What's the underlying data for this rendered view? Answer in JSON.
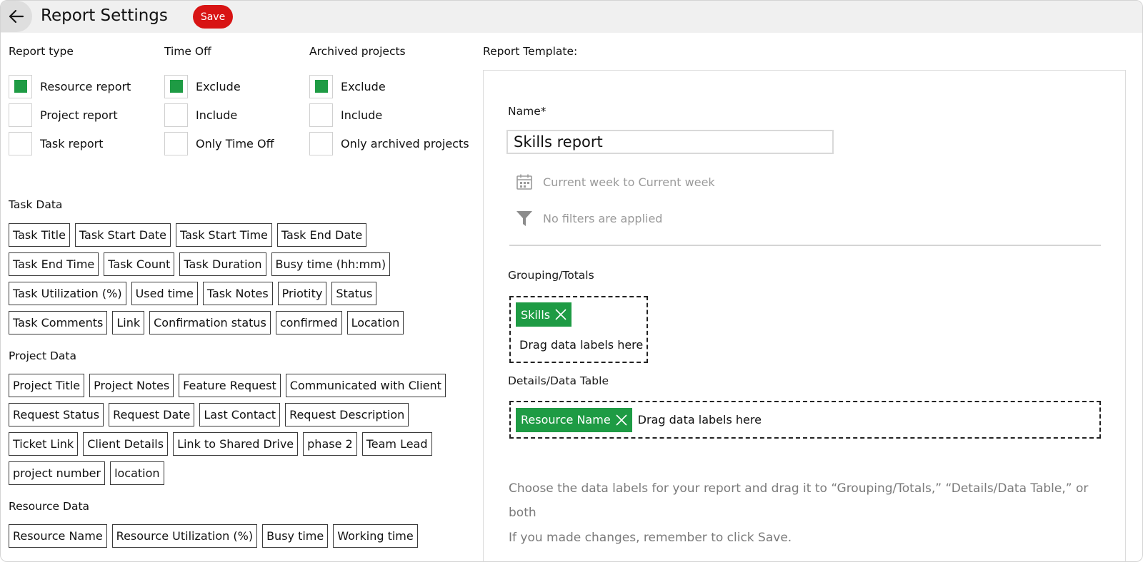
{
  "header": {
    "title": "Report Settings",
    "save_label": "Save"
  },
  "report_type": {
    "label": "Report type",
    "options": [
      {
        "label": "Resource report",
        "checked": true
      },
      {
        "label": "Project report",
        "checked": false
      },
      {
        "label": "Task report",
        "checked": false
      }
    ]
  },
  "time_off": {
    "label": "Time Off",
    "options": [
      {
        "label": "Exclude",
        "checked": true
      },
      {
        "label": "Include",
        "checked": false
      },
      {
        "label": "Only Time Off",
        "checked": false
      }
    ]
  },
  "archived": {
    "label": "Archived projects",
    "options": [
      {
        "label": "Exclude",
        "checked": true
      },
      {
        "label": "Include",
        "checked": false
      },
      {
        "label": "Only archived projects",
        "checked": false
      }
    ]
  },
  "task_data": {
    "label": "Task Data",
    "rows": [
      [
        "Task Title",
        "Task Start Date",
        "Task Start Time",
        "Task End Date"
      ],
      [
        "Task End Time",
        "Task Count",
        "Task Duration",
        "Busy time (hh:mm)"
      ],
      [
        "Task Utilization (%)",
        "Used time",
        "Task Notes",
        "Priotity",
        "Status"
      ],
      [
        "Task Comments",
        "Link",
        "Confirmation status",
        "confirmed",
        "Location"
      ]
    ]
  },
  "project_data": {
    "label": "Project Data",
    "rows": [
      [
        "Project Title",
        "Project Notes",
        "Feature Request",
        "Communicated with Client"
      ],
      [
        "Request Status",
        "Request Date",
        "Last Contact",
        "Request Description"
      ],
      [
        "Ticket Link",
        "Client Details",
        "Link to Shared Drive",
        "phase 2",
        "Team Lead"
      ],
      [
        "project number",
        "location"
      ]
    ]
  },
  "resource_data": {
    "label": "Resource Data",
    "rows": [
      [
        "Resource Name",
        "Resource Utilization (%)",
        "Busy time",
        "Working time"
      ]
    ]
  },
  "template": {
    "title": "Report Template:",
    "name_label": "Name*",
    "name_value": "Skills report",
    "date_range": "Current week to Current week",
    "filters": "No filters are applied",
    "grouping_label": "Grouping/Totals",
    "grouping_chips": [
      "Skills"
    ],
    "grouping_hint": "Drag data labels here",
    "details_label": "Details/Data Table",
    "details_chips": [
      "Resource Name"
    ],
    "details_hint": "Drag data labels here",
    "help_line1": "Choose the data labels for your report and drag it to “Grouping/Totals,” “Details/Data Table,” or both",
    "help_line2": "If you made changes, remember to click Save."
  },
  "colors": {
    "accent_green": "#1e9b44",
    "save_red": "#d81414"
  },
  "icons": {
    "back": "arrow-left-icon",
    "calendar": "calendar-icon",
    "filter": "filter-icon",
    "remove": "close-icon"
  }
}
